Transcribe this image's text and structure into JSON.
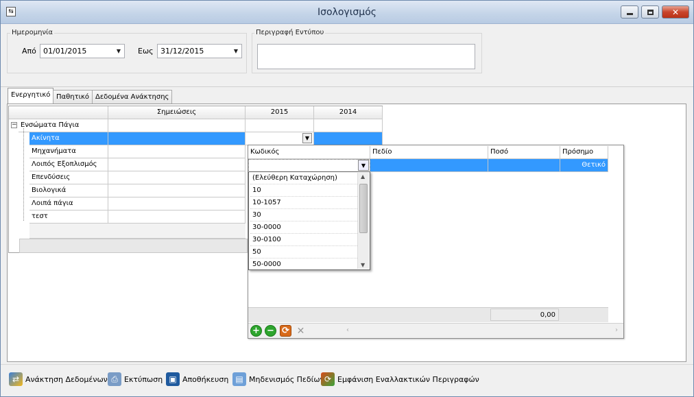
{
  "window": {
    "title": "Ισολογισμός"
  },
  "date_group": {
    "label": "Ημερομηνία",
    "from_label": "Από",
    "from_value": "01/01/2015",
    "to_label": "Εως",
    "to_value": "31/12/2015"
  },
  "description_group": {
    "label": "Περιγραφή Εντύπου",
    "value": ""
  },
  "tabs": [
    {
      "label": "Ενεργητικό",
      "active": true
    },
    {
      "label": "Παθητικό",
      "active": false
    },
    {
      "label": "Δεδομένα Ανάκτησης",
      "active": false
    }
  ],
  "grid": {
    "columns": [
      "Σημειώσεις",
      "2015",
      "2014"
    ],
    "parent_row": "Ενσώματα Πάγια",
    "rows": [
      "Ακίνητα",
      "Μηχανήματα",
      "Λοιπός Εξοπλισμός",
      "Επενδύσεις",
      "Βιολογικά",
      "Λοιπά πάγια",
      "τεστ"
    ],
    "selected_row": "Ακίνητα"
  },
  "popup": {
    "columns": [
      "Κωδικός",
      "Πεδίο",
      "Ποσό",
      "Πρόσημο"
    ],
    "row": {
      "code": "",
      "field": "",
      "amount": "",
      "sign": "Θετικό"
    },
    "total": "0,00"
  },
  "code_dropdown": {
    "options": [
      "(Ελεύθερη Καταχώρηση)",
      "10",
      "10-1057",
      "30",
      "30-0000",
      "30-0100",
      "50",
      "50-0000"
    ]
  },
  "footer": {
    "retrieve": "Ανάκτηση Δεδομένων",
    "print": "Εκτύπωση",
    "save": "Αποθήκευση",
    "clear": "Μηδενισμός Πεδίων",
    "alt": "Εμφάνιση Εναλλακτικών Περιγραφών"
  },
  "colors": {
    "selection": "#3399ff",
    "title_text": "#1e2f4a"
  }
}
